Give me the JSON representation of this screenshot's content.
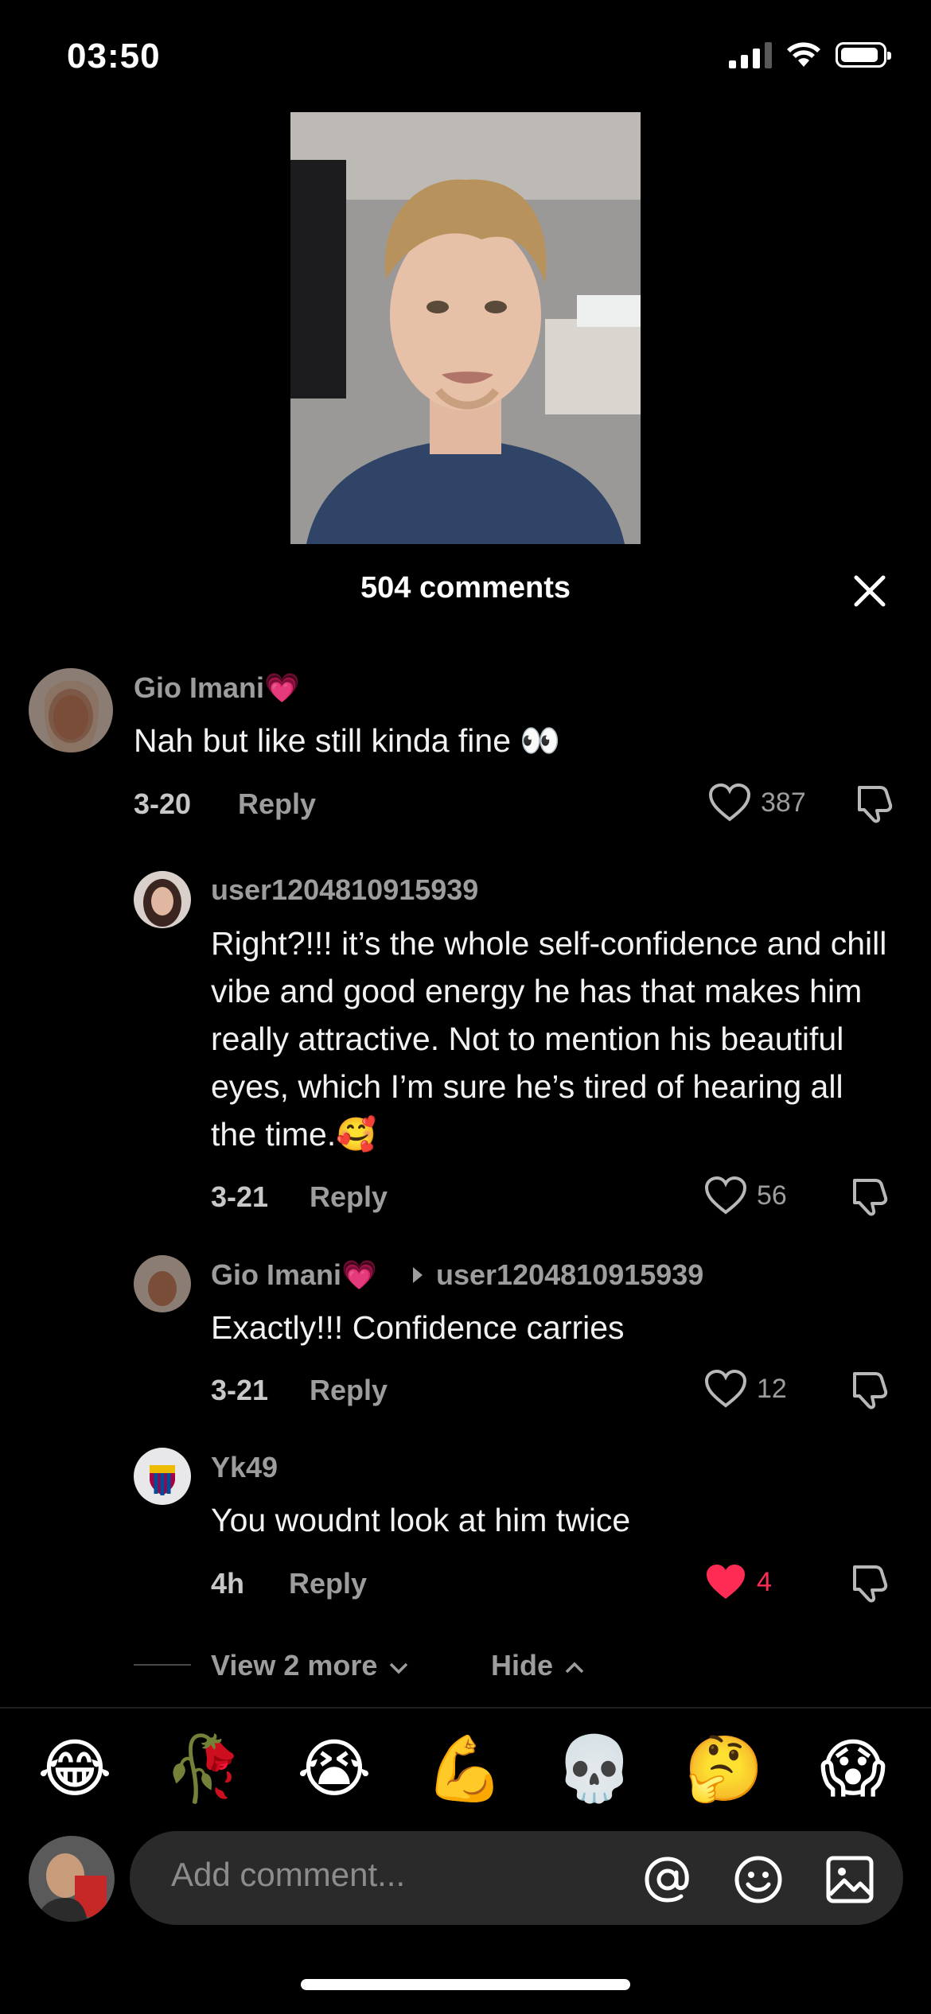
{
  "status_bar": {
    "time": "03:50"
  },
  "header": {
    "comments_count": "504 comments"
  },
  "comments": [
    {
      "username": "Gio Imani💗",
      "text": "Nah but like still kinda fine 👀",
      "date": "3-20",
      "reply_label": "Reply",
      "likes": "387"
    },
    {
      "username": "user1204810915939",
      "text": "Right?!!! it’s the whole self-confidence and chill vibe and good energy he has that makes him really attractive. Not to mention his beautiful eyes, which I’m sure he’s tired of hearing all the time.🥰",
      "date": "3-21",
      "reply_label": "Reply",
      "likes": "56"
    },
    {
      "username": "Gio Imani💗",
      "reply_to": "user1204810915939",
      "text": "Exactly!!! Confidence carries",
      "date": "3-21",
      "reply_label": "Reply",
      "likes": "12"
    },
    {
      "username": "Yk49",
      "text": "You woudnt look at him twice",
      "date": "4h",
      "reply_label": "Reply",
      "likes": "4",
      "liked": true
    }
  ],
  "thread_controls": {
    "view_more": "View 2 more",
    "hide": "Hide"
  },
  "emoji_bar": [
    "😂",
    "🥀",
    "😭",
    "💪",
    "💀",
    "🤔",
    "😱"
  ],
  "composer": {
    "placeholder": "Add comment..."
  },
  "colors": {
    "background": "#000000",
    "accent_like": "#fe2c55",
    "muted_text": "#9d9d9d"
  }
}
